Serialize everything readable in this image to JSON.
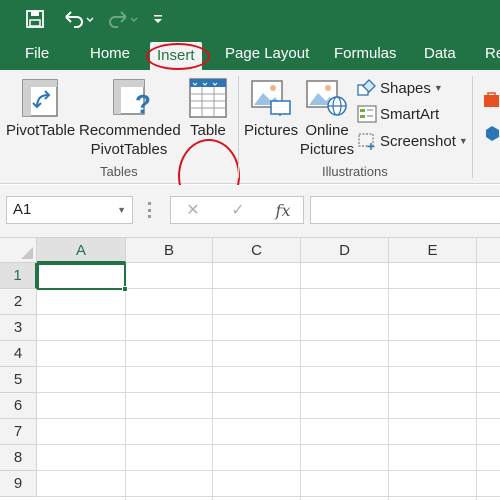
{
  "tabs": [
    {
      "label": "File"
    },
    {
      "label": "Home"
    },
    {
      "label": "Insert"
    },
    {
      "label": "Page Layout"
    },
    {
      "label": "Formulas"
    },
    {
      "label": "Data"
    },
    {
      "label": "Re"
    }
  ],
  "active_tab": "Insert",
  "ribbon": {
    "pivottable": "PivotTable",
    "recommended_line1": "Recommended",
    "recommended_line2": "PivotTables",
    "table": "Table",
    "tables_group": "Tables",
    "pictures": "Pictures",
    "online_line1": "Online",
    "online_line2": "Pictures",
    "shapes": "Shapes",
    "smartart": "SmartArt",
    "screenshot": "Screenshot",
    "illustrations_group": "Illustrations"
  },
  "formula_bar": {
    "name_box": "A1",
    "fx": "fx",
    "formula": ""
  },
  "grid": {
    "columns": [
      "A",
      "B",
      "C",
      "D",
      "E"
    ],
    "rows": [
      "1",
      "2",
      "3",
      "4",
      "5",
      "6",
      "7",
      "8",
      "9"
    ],
    "selected_cell": "A1"
  },
  "colors": {
    "brand_green": "#217346",
    "annotation_red": "#d8121b"
  }
}
